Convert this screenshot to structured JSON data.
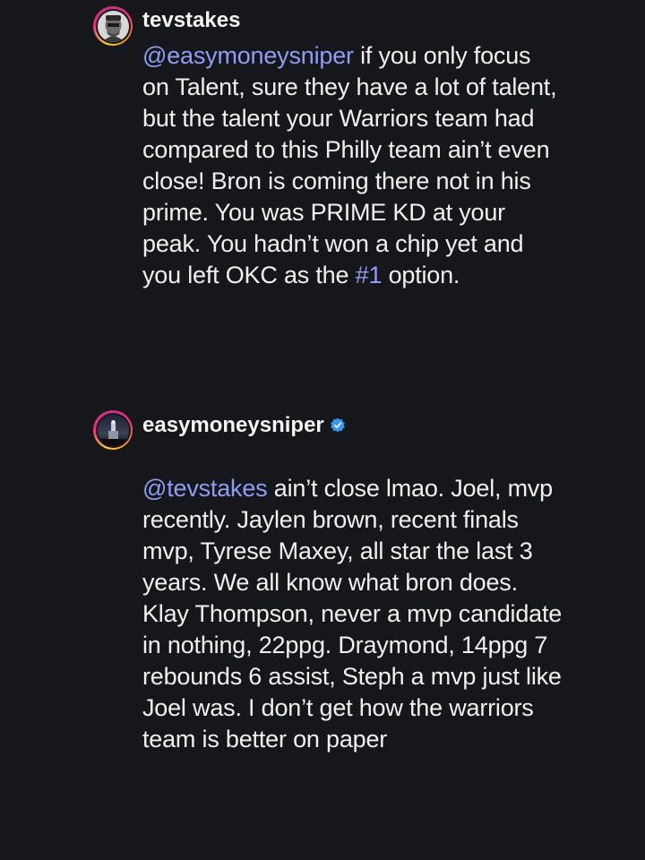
{
  "comments": [
    {
      "username": "tevstakes",
      "verified": false,
      "mention": "@easymoneysniper",
      "text_part1": " if you only focus on Talent, sure they have a lot of talent, but the talent your Warriors team had compared to this Philly team ain’t even close! Bron is coming there not in his prime. You was PRIME KD at your peak. You hadn’t won a chip yet and you left OKC as the ",
      "hashtag": "#1",
      "text_part2": " option."
    },
    {
      "username": "easymoneysniper",
      "verified": true,
      "mention": "@tevstakes",
      "text_part1": " ain’t close lmao. Joel, mvp recently. Jaylen brown, recent finals mvp, Tyrese Maxey, all star the last 3 years. We all know what bron does. Klay Thompson, never a mvp candidate in nothing, 22ppg. Draymond, 14ppg 7 rebounds 6 assist, Steph a mvp just like Joel was. I don’t get how the warriors team is better on paper"
    }
  ],
  "icons": {
    "verified_badge": "verified-badge-icon",
    "verified_color": "#3897f0"
  },
  "colors": {
    "background": "#16171b",
    "text": "#f0f0f2",
    "link": "#8e9ef2"
  }
}
